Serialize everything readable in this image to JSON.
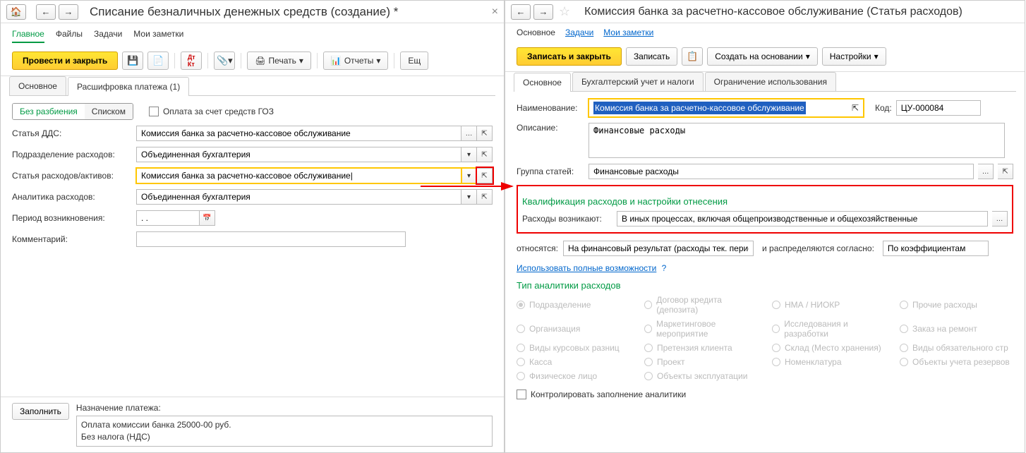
{
  "left": {
    "title": "Списание безналичных денежных средств (создание) *",
    "tabs": [
      "Главное",
      "Файлы",
      "Задачи",
      "Мои заметки"
    ],
    "toolbar": {
      "post_close": "Провести и закрыть",
      "print": "Печать",
      "reports": "Отчеты",
      "more": "Ещ"
    },
    "subtabs": [
      "Основное",
      "Расшифровка платежа (1)"
    ],
    "toggle": {
      "no_split": "Без разбиения",
      "list": "Списком"
    },
    "goz_checkbox": "Оплата за счет средств ГОЗ",
    "fields": {
      "dds_label": "Статья ДДС:",
      "dds_value": "Комиссия банка за расчетно-кассовое обслуживание",
      "unit_label": "Подразделение расходов:",
      "unit_value": "Объединенная бухгалтерия",
      "expense_label": "Статья расходов/активов:",
      "expense_value": "Комиссия банка за расчетно-кассовое обслуживание|",
      "analytics_label": "Аналитика расходов:",
      "analytics_value": "Объединенная бухгалтерия",
      "period_label": "Период возникновения:",
      "period_value": ". .",
      "comment_label": "Комментарий:"
    },
    "bottom": {
      "fill": "Заполнить",
      "purpose_label": "Назначение платежа:",
      "purpose_line1": "Оплата комиссии банка 25000-00 руб.",
      "purpose_line2": "Без налога (НДС)"
    }
  },
  "right": {
    "title": "Комиссия банка за расчетно-кассовое обслуживание (Статья расходов)",
    "links": [
      "Основное",
      "Задачи",
      "Мои заметки"
    ],
    "toolbar": {
      "save_close": "Записать и закрыть",
      "save": "Записать",
      "create_based": "Создать на основании",
      "settings": "Настройки"
    },
    "subtabs": [
      "Основное",
      "Бухгалтерский учет и налоги",
      "Ограничение использования"
    ],
    "name_label": "Наименование:",
    "name_value": "Комиссия банка за расчетно-кассовое обслуживание",
    "code_label": "Код:",
    "code_value": "ЦУ-000084",
    "desc_label": "Описание:",
    "desc_value": "Финансовые расходы",
    "group_label": "Группа статей:",
    "group_value": "Финансовые расходы",
    "qual_title": "Квалификация расходов и настройки отнесения",
    "arise_label": "Расходы возникают:",
    "arise_value": "В иных процессах, включая общепроизводственные и общехозяйственные",
    "relate_label": "относятся:",
    "relate_value": "На финансовый результат (расходы тек. перио,",
    "distrib_label": "и распределяются согласно:",
    "distrib_value": "По коэффициентам",
    "full_link": "Использовать полные возможности",
    "analytics_title": "Тип аналитики расходов",
    "radios": [
      "Подразделение",
      "Договор кредита (депозита)",
      "НМА / НИОКР",
      "Прочие расходы",
      "Организация",
      "Маркетинговое мероприятие",
      "Исследования и разработки",
      "Заказ на ремонт",
      "Виды курсовых разниц",
      "Претензия клиента",
      "Склад (Место хранения)",
      "Виды обязательного стр",
      "Касса",
      "Проект",
      "Номенклатура",
      "Объекты учета резервов",
      "Физическое лицо",
      "Объекты эксплуатации",
      "",
      ""
    ],
    "control_check": "Контролировать заполнение аналитики"
  }
}
